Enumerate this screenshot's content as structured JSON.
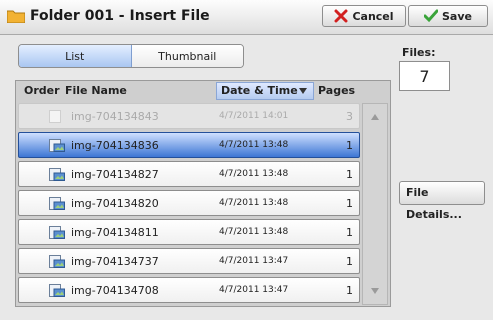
{
  "window": {
    "title": "Folder 001 - Insert File"
  },
  "toolbar": {
    "cancel_label": "Cancel",
    "save_label": "Save"
  },
  "view_toggle": {
    "list_label": "List",
    "thumbnail_label": "Thumbnail",
    "selected": "List"
  },
  "files": {
    "label": "Files:",
    "count": "7"
  },
  "table": {
    "headers": {
      "order": "Order",
      "file_name": "File Name",
      "date_time": "Date & Time",
      "pages": "Pages"
    },
    "rows": [
      {
        "name": "img-704134843",
        "date": "4/7/2011 14:01",
        "pages": "3",
        "state": "disabled"
      },
      {
        "name": "img-704134836",
        "date": "4/7/2011 13:48",
        "pages": "1",
        "state": "selected"
      },
      {
        "name": "img-704134827",
        "date": "4/7/2011 13:48",
        "pages": "1",
        "state": "normal"
      },
      {
        "name": "img-704134820",
        "date": "4/7/2011 13:48",
        "pages": "1",
        "state": "normal"
      },
      {
        "name": "img-704134811",
        "date": "4/7/2011 13:48",
        "pages": "1",
        "state": "normal"
      },
      {
        "name": "img-704134737",
        "date": "4/7/2011 13:47",
        "pages": "1",
        "state": "normal"
      },
      {
        "name": "img-704134708",
        "date": "4/7/2011 13:47",
        "pages": "1",
        "state": "normal"
      }
    ]
  },
  "details_button": {
    "label": "File Details..."
  },
  "colors": {
    "selected_row": "#3d76d4",
    "cancel_icon": "#d22020",
    "save_icon": "#3aa43a",
    "folder": "#f2b233"
  }
}
